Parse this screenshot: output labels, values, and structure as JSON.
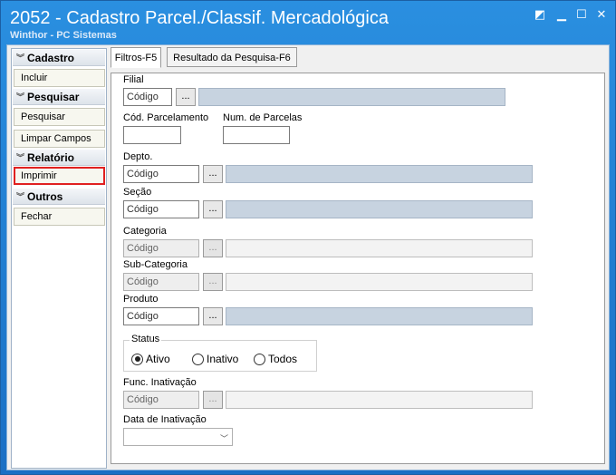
{
  "window": {
    "title": "2052 - Cadastro Parcel./Classif. Mercadológica",
    "subtitle": "Winthor - PC Sistemas"
  },
  "sidebar": {
    "cadastro": {
      "header": "Cadastro",
      "incluir": "Incluir"
    },
    "pesquisar": {
      "header": "Pesquisar",
      "pesquisar": "Pesquisar",
      "limpar": "Limpar Campos"
    },
    "relatorio": {
      "header": "Relatório",
      "imprimir": "Imprimir"
    },
    "outros": {
      "header": "Outros",
      "fechar": "Fechar"
    }
  },
  "tabs": {
    "filtros": "Filtros-F5",
    "resultado": "Resultado da Pesquisa-F6"
  },
  "form": {
    "filial": {
      "label": "Filial",
      "placeholder": "Código",
      "button": "..."
    },
    "cod_parcelamento": {
      "label": "Cód. Parcelamento"
    },
    "num_parcelas": {
      "label": "Num. de Parcelas"
    },
    "depto": {
      "label": "Depto.",
      "placeholder": "Código",
      "button": "..."
    },
    "secao": {
      "label": "Seção",
      "placeholder": "Código",
      "button": "..."
    },
    "categoria": {
      "label": "Categoria",
      "placeholder": "Código",
      "button": "..."
    },
    "subcategoria": {
      "label": "Sub-Categoria",
      "placeholder": "Código",
      "button": "..."
    },
    "produto": {
      "label": "Produto",
      "placeholder": "Código",
      "button": "..."
    },
    "status": {
      "label": "Status",
      "ativo": "Ativo",
      "inativo": "Inativo",
      "todos": "Todos",
      "selected": "Ativo"
    },
    "func_inativacao": {
      "label": "Func. Inativação",
      "placeholder": "Código",
      "button": "..."
    },
    "data_inativacao": {
      "label": "Data de Inativação"
    }
  }
}
